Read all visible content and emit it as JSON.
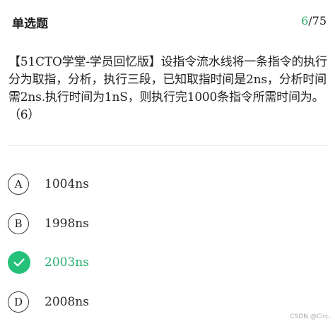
{
  "header": {
    "title": "单选题",
    "progress_current": "6",
    "progress_total": "/75"
  },
  "question": {
    "text": "【51CTO学堂-学员回忆版】设指令流水线将一条指令的执行分为取指，分析，执行三段，已知取指时间是2ns，分析时间需2ns.执行时间为1nS，则执行完1000条指令所需时间为。（6）"
  },
  "options": [
    {
      "letter": "A",
      "text": "1004ns",
      "state": "normal"
    },
    {
      "letter": "B",
      "text": "1998ns",
      "state": "normal"
    },
    {
      "letter": "C",
      "text": "2003ns",
      "state": "correct"
    },
    {
      "letter": "D",
      "text": "2008ns",
      "state": "normal"
    }
  ],
  "watermark": "CSDN @Circ.",
  "colors": {
    "accent": "#25c07a",
    "text": "#1f1f1f",
    "divider": "#e8e8e8"
  },
  "icons": {
    "correct": "checkmark-icon"
  }
}
